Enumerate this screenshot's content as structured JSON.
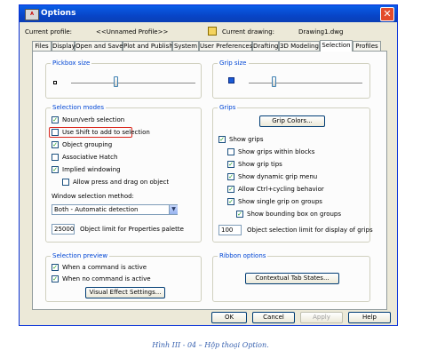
{
  "window": {
    "title": "Options",
    "title_icon_text": "A"
  },
  "profile": {
    "label": "Current profile:",
    "value": "<<Unnamed Profile>>"
  },
  "drawing": {
    "label": "Current drawing:",
    "value": "Drawing1.dwg"
  },
  "tabs": [
    "Files",
    "Display",
    "Open and Save",
    "Plot and Publish",
    "System",
    "User Preferences",
    "Drafting",
    "3D Modeling",
    "Selection",
    "Profiles"
  ],
  "active_tab": "Selection",
  "pickbox": {
    "title": "Pickbox size"
  },
  "grip_size": {
    "title": "Grip size"
  },
  "selection_modes": {
    "title": "Selection modes",
    "noun_verb": {
      "label": "Noun/verb selection",
      "checked": true
    },
    "use_shift": {
      "label": "Use Shift to add to selection",
      "checked": false
    },
    "object_grouping": {
      "label": "Object grouping",
      "checked": true
    },
    "associative_hatch": {
      "label": "Associative Hatch",
      "checked": false
    },
    "implied_windowing": {
      "label": "Implied windowing",
      "checked": true
    },
    "press_drag": {
      "label": "Allow press and drag on object",
      "checked": false
    },
    "window_method_label": "Window selection method:",
    "window_method_value": "Both - Automatic detection",
    "object_limit_value": "25000",
    "object_limit_label": "Object limit for Properties palette"
  },
  "grips": {
    "title": "Grips",
    "grip_colors_button": "Grip Colors...",
    "show_grips": {
      "label": "Show grips",
      "checked": true
    },
    "show_grips_blocks": {
      "label": "Show grips within blocks",
      "checked": false
    },
    "show_grip_tips": {
      "label": "Show grip tips",
      "checked": true
    },
    "show_dynamic_grip_menu": {
      "label": "Show dynamic grip menu",
      "checked": true
    },
    "allow_ctrl_cycling": {
      "label": "Allow Ctrl+cycling behavior",
      "checked": true
    },
    "show_single_grip": {
      "label": "Show single grip on groups",
      "checked": true
    },
    "show_bounding_box": {
      "label": "Show bounding box on groups",
      "checked": true
    },
    "grip_limit_value": "100",
    "grip_limit_label": "Object selection limit for display of grips"
  },
  "selection_preview": {
    "title": "Selection preview",
    "command_active": {
      "label": "When a command is active",
      "checked": true
    },
    "no_command": {
      "label": "When no command is active",
      "checked": true
    },
    "visual_effect_button": "Visual Effect Settings..."
  },
  "ribbon": {
    "title": "Ribbon options",
    "contextual_button": "Contextual Tab States..."
  },
  "footer": {
    "ok": "OK",
    "cancel": "Cancel",
    "apply": "Apply",
    "help": "Help"
  },
  "caption": "Hình III - 04 – Hộp thoại Option.",
  "colors": {
    "title_bar": "#0a5fe8",
    "group_title": "#0046d5",
    "highlight_box": "#d9261c",
    "grip_square": "#1a5bd6"
  },
  "icons": [
    "app-icon",
    "close-icon",
    "drawing-icon",
    "dropdown-arrow-icon",
    "checkmark-icon"
  ]
}
